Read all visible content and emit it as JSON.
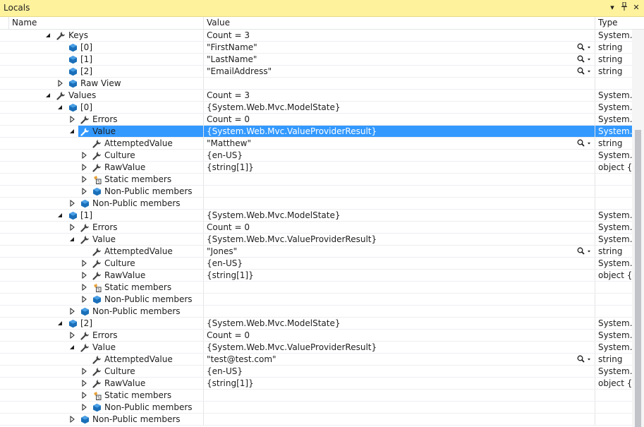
{
  "window": {
    "title": "Locals",
    "dropdown_glyph": "▾",
    "pin_glyph": "📌",
    "close_glyph": "✕"
  },
  "columns": {
    "name": "Name",
    "value": "Value",
    "type": "Type"
  },
  "rows": [
    {
      "name": "Keys",
      "value": "Count = 3",
      "type": "System.Collections.Generic.Dictionary",
      "depth": 0,
      "exp": "open",
      "icon": "wrench",
      "mag": false
    },
    {
      "name": "[0]",
      "value": "\"FirstName\"",
      "type": "string",
      "depth": 1,
      "exp": "none",
      "icon": "field",
      "mag": true
    },
    {
      "name": "[1]",
      "value": "\"LastName\"",
      "type": "string",
      "depth": 1,
      "exp": "none",
      "icon": "field",
      "mag": true
    },
    {
      "name": "[2]",
      "value": "\"EmailAddress\"",
      "type": "string",
      "depth": 1,
      "exp": "none",
      "icon": "field",
      "mag": true
    },
    {
      "name": "Raw View",
      "value": "",
      "type": "",
      "depth": 1,
      "exp": "closed",
      "icon": "field",
      "mag": false
    },
    {
      "name": "Values",
      "value": "Count = 3",
      "type": "System.Collections.Generic.Dictionary",
      "depth": 0,
      "exp": "open",
      "icon": "wrench",
      "mag": false
    },
    {
      "name": "[0]",
      "value": "{System.Web.Mvc.ModelState}",
      "type": "System.Web.Mvc.ModelState",
      "depth": 1,
      "exp": "open",
      "icon": "field",
      "mag": false
    },
    {
      "name": "Errors",
      "value": "Count = 0",
      "type": "System.Web.Mvc.ModelErrorCollection",
      "depth": 2,
      "exp": "closed",
      "icon": "wrench",
      "mag": false
    },
    {
      "name": "Value",
      "value": "{System.Web.Mvc.ValueProviderResult}",
      "type": "System.Web.Mvc.ValueProviderResult",
      "depth": 2,
      "exp": "open",
      "icon": "wrench",
      "mag": false,
      "selected": true
    },
    {
      "name": "AttemptedValue",
      "value": "\"Matthew\"",
      "type": "string",
      "depth": 3,
      "exp": "none",
      "icon": "wrench",
      "mag": true
    },
    {
      "name": "Culture",
      "value": "{en-US}",
      "type": "System.Globalization.CultureInfo",
      "depth": 3,
      "exp": "closed",
      "icon": "wrench",
      "mag": false
    },
    {
      "name": "RawValue",
      "value": "{string[1]}",
      "type": "object {string[]}",
      "depth": 3,
      "exp": "closed",
      "icon": "wrench",
      "mag": false
    },
    {
      "name": "Static members",
      "value": "",
      "type": "",
      "depth": 3,
      "exp": "closed",
      "icon": "static",
      "mag": false
    },
    {
      "name": "Non-Public members",
      "value": "",
      "type": "",
      "depth": 3,
      "exp": "closed",
      "icon": "field",
      "mag": false
    },
    {
      "name": "Non-Public members",
      "value": "",
      "type": "",
      "depth": 2,
      "exp": "closed",
      "icon": "field",
      "mag": false
    },
    {
      "name": "[1]",
      "value": "{System.Web.Mvc.ModelState}",
      "type": "System.Web.Mvc.ModelState",
      "depth": 1,
      "exp": "open",
      "icon": "field",
      "mag": false
    },
    {
      "name": "Errors",
      "value": "Count = 0",
      "type": "System.Web.Mvc.ModelErrorCollection",
      "depth": 2,
      "exp": "closed",
      "icon": "wrench",
      "mag": false
    },
    {
      "name": "Value",
      "value": "{System.Web.Mvc.ValueProviderResult}",
      "type": "System.Web.Mvc.ValueProviderResult",
      "depth": 2,
      "exp": "open",
      "icon": "wrench",
      "mag": false
    },
    {
      "name": "AttemptedValue",
      "value": "\"Jones\"",
      "type": "string",
      "depth": 3,
      "exp": "none",
      "icon": "wrench",
      "mag": true
    },
    {
      "name": "Culture",
      "value": "{en-US}",
      "type": "System.Globalization.CultureInfo",
      "depth": 3,
      "exp": "closed",
      "icon": "wrench",
      "mag": false
    },
    {
      "name": "RawValue",
      "value": "{string[1]}",
      "type": "object {string[]}",
      "depth": 3,
      "exp": "closed",
      "icon": "wrench",
      "mag": false
    },
    {
      "name": "Static members",
      "value": "",
      "type": "",
      "depth": 3,
      "exp": "closed",
      "icon": "static",
      "mag": false
    },
    {
      "name": "Non-Public members",
      "value": "",
      "type": "",
      "depth": 3,
      "exp": "closed",
      "icon": "field",
      "mag": false
    },
    {
      "name": "Non-Public members",
      "value": "",
      "type": "",
      "depth": 2,
      "exp": "closed",
      "icon": "field",
      "mag": false
    },
    {
      "name": "[2]",
      "value": "{System.Web.Mvc.ModelState}",
      "type": "System.Web.Mvc.ModelState",
      "depth": 1,
      "exp": "open",
      "icon": "field",
      "mag": false
    },
    {
      "name": "Errors",
      "value": "Count = 0",
      "type": "System.Web.Mvc.ModelErrorCollection",
      "depth": 2,
      "exp": "closed",
      "icon": "wrench",
      "mag": false
    },
    {
      "name": "Value",
      "value": "{System.Web.Mvc.ValueProviderResult}",
      "type": "System.Web.Mvc.ValueProviderResult",
      "depth": 2,
      "exp": "open",
      "icon": "wrench",
      "mag": false
    },
    {
      "name": "AttemptedValue",
      "value": "\"test@test.com\"",
      "type": "string",
      "depth": 3,
      "exp": "none",
      "icon": "wrench",
      "mag": true
    },
    {
      "name": "Culture",
      "value": "{en-US}",
      "type": "System.Globalization.CultureInfo",
      "depth": 3,
      "exp": "closed",
      "icon": "wrench",
      "mag": false
    },
    {
      "name": "RawValue",
      "value": "{string[1]}",
      "type": "object {string[]}",
      "depth": 3,
      "exp": "closed",
      "icon": "wrench",
      "mag": false
    },
    {
      "name": "Static members",
      "value": "",
      "type": "",
      "depth": 3,
      "exp": "closed",
      "icon": "static",
      "mag": false
    },
    {
      "name": "Non-Public members",
      "value": "",
      "type": "",
      "depth": 3,
      "exp": "closed",
      "icon": "field",
      "mag": false
    },
    {
      "name": "Non-Public members",
      "value": "",
      "type": "",
      "depth": 2,
      "exp": "closed",
      "icon": "field",
      "mag": false
    }
  ],
  "colors": {
    "titlebar": "#fff29d",
    "selection": "#3399ff",
    "field_icon": "#1b6fb8",
    "wrench_icon": "#424242",
    "static_icon": "#e8a33c"
  },
  "icons": {
    "field": "field-icon",
    "wrench": "property-icon",
    "static": "static-members-icon",
    "search": "magnifier-icon"
  }
}
